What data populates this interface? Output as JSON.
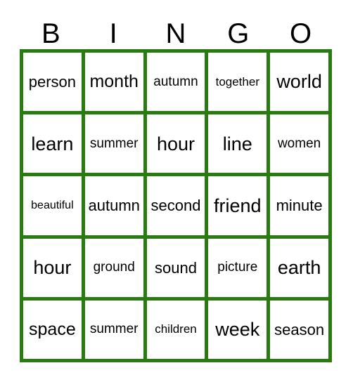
{
  "card": {
    "title": "BINGO",
    "border_color": "#2a7a12",
    "cell_background": "#ffffff",
    "text_color": "#000000",
    "headers": [
      "B",
      "I",
      "N",
      "G",
      "O"
    ],
    "rows": [
      [
        {
          "word": "person",
          "size": "md"
        },
        {
          "word": "month",
          "size": "lg"
        },
        {
          "word": "autumn",
          "size": "sm"
        },
        {
          "word": "together",
          "size": "xs"
        },
        {
          "word": "world",
          "size": "xl"
        }
      ],
      [
        {
          "word": "learn",
          "size": "xl"
        },
        {
          "word": "summer",
          "size": "sm"
        },
        {
          "word": "hour",
          "size": "xl"
        },
        {
          "word": "line",
          "size": "xl"
        },
        {
          "word": "women",
          "size": "sm"
        }
      ],
      [
        {
          "word": "beautiful",
          "size": "xxs"
        },
        {
          "word": "autumn",
          "size": "md"
        },
        {
          "word": "second",
          "size": "md"
        },
        {
          "word": "friend",
          "size": "xl"
        },
        {
          "word": "minute",
          "size": "md"
        }
      ],
      [
        {
          "word": "hour",
          "size": "xl"
        },
        {
          "word": "ground",
          "size": "sm"
        },
        {
          "word": "sound",
          "size": "md"
        },
        {
          "word": "picture",
          "size": "sm"
        },
        {
          "word": "earth",
          "size": "xl"
        }
      ],
      [
        {
          "word": "space",
          "size": "lg"
        },
        {
          "word": "summer",
          "size": "sm"
        },
        {
          "word": "children",
          "size": "xs"
        },
        {
          "word": "week",
          "size": "xl"
        },
        {
          "word": "season",
          "size": "md"
        }
      ]
    ]
  }
}
